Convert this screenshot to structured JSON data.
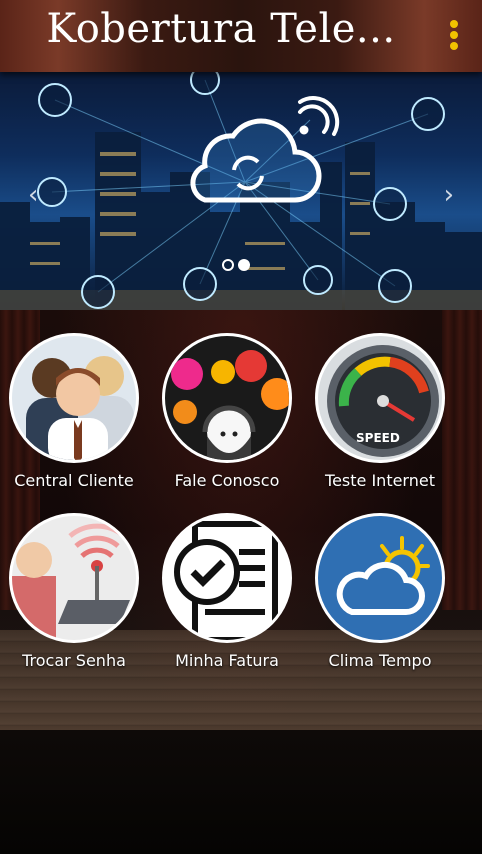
{
  "appbar": {
    "title": "Kobertura Tele...",
    "menu_icon": "overflow-menu-icon"
  },
  "banner": {
    "prev_icon": "chevron-left-icon",
    "next_icon": "chevron-right-icon",
    "slides_total": 2,
    "active_slide": 2
  },
  "menu": [
    {
      "label": "Central Cliente",
      "icon": "customers-icon"
    },
    {
      "label": "Fale Conosco",
      "icon": "support-agent-icon"
    },
    {
      "label": "Teste Internet",
      "icon": "speedometer-icon",
      "gauge_text": "SPEED"
    },
    {
      "label": "Trocar Senha",
      "icon": "router-icon"
    },
    {
      "label": "Minha Fatura",
      "icon": "invoice-icon"
    },
    {
      "label": "Clima Tempo",
      "icon": "weather-icon"
    }
  ],
  "colors": {
    "menu_dots": "#f2c400",
    "weather_bg": "#2f6fb3"
  }
}
